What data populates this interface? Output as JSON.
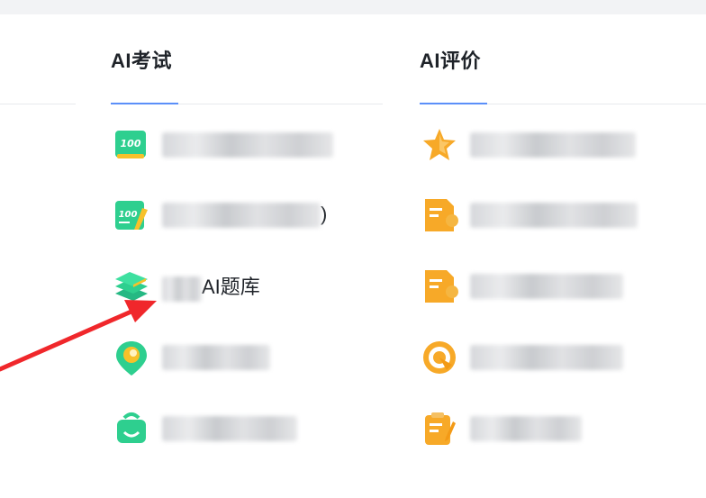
{
  "columns": {
    "exam": {
      "title": "AI考试",
      "items": [
        {
          "label": "",
          "icon": "score-100-icon"
        },
        {
          "label": ")",
          "icon": "score-100-pencil-icon"
        },
        {
          "label": "AI题库",
          "icon": "book-stack-icon"
        },
        {
          "label": "",
          "icon": "location-pin-icon"
        },
        {
          "label": "",
          "icon": "bag-icon"
        }
      ]
    },
    "eval": {
      "title": "AI评价",
      "items": [
        {
          "label": "",
          "icon": "star-icon"
        },
        {
          "label": "",
          "icon": "document-icon"
        },
        {
          "label": "",
          "icon": "document-icon"
        },
        {
          "label": "",
          "icon": "target-icon"
        },
        {
          "label": "",
          "icon": "clipboard-icon"
        }
      ]
    }
  },
  "colors": {
    "accent": "#5b8ff9",
    "green_icon": "#2ecf8f",
    "orange_icon": "#f7a928",
    "arrow": "#f0272b"
  }
}
